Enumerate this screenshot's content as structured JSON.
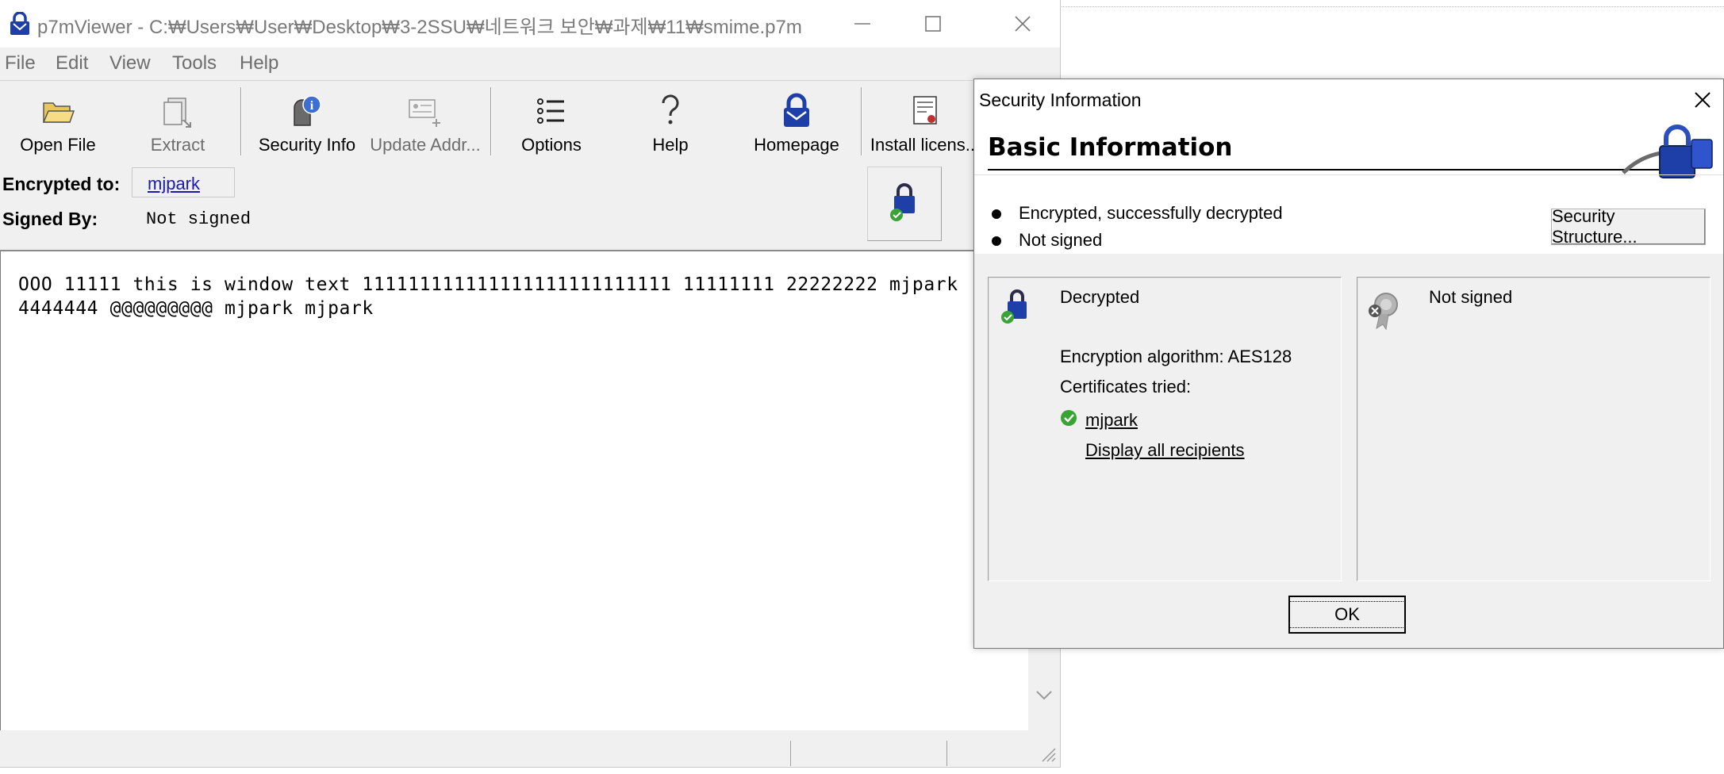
{
  "main_window": {
    "title": "p7mViewer - C:₩Users₩User₩Desktop₩3-2SSU₩네트워크 보안₩과제₩11₩smime.p7m",
    "menu": [
      "File",
      "Edit",
      "View",
      "Tools",
      "Help"
    ],
    "toolbar": {
      "open_file": "Open File",
      "extract": "Extract",
      "security_info": "Security Info",
      "update_addr": "Update Addr...",
      "options": "Options",
      "help": "Help",
      "homepage": "Homepage",
      "install_license": "Install licens..."
    },
    "info": {
      "encrypted_to_label": "Encrypted to:",
      "encrypted_to_value": "mjpark",
      "signed_by_label": "Signed By:",
      "signed_by_value": "Not signed"
    },
    "message_lines": [
      "OOO 11111 this is window text 111111111111111111111111111 11111111 22222222 mjpark",
      "4444444 @@@@@@@@@ mjpark mjpark"
    ]
  },
  "dialog": {
    "title": "Security Information",
    "heading": "Basic Information",
    "status_lines": [
      "Encrypted, successfully decrypted",
      "Not signed"
    ],
    "security_structure_button": "Security Structure...",
    "decrypt_panel": {
      "title": "Decrypted",
      "algorithm": "Encryption algorithm: AES128",
      "certs_label": "Certificates tried:",
      "cert_name": "mjpark",
      "display_all": "Display all recipients"
    },
    "sign_panel": {
      "title": "Not signed"
    },
    "ok_button": "OK"
  },
  "icons": {
    "app": "lock-envelope-icon",
    "accent_blue": "#1f3fa8",
    "check_green": "#3aa335"
  }
}
